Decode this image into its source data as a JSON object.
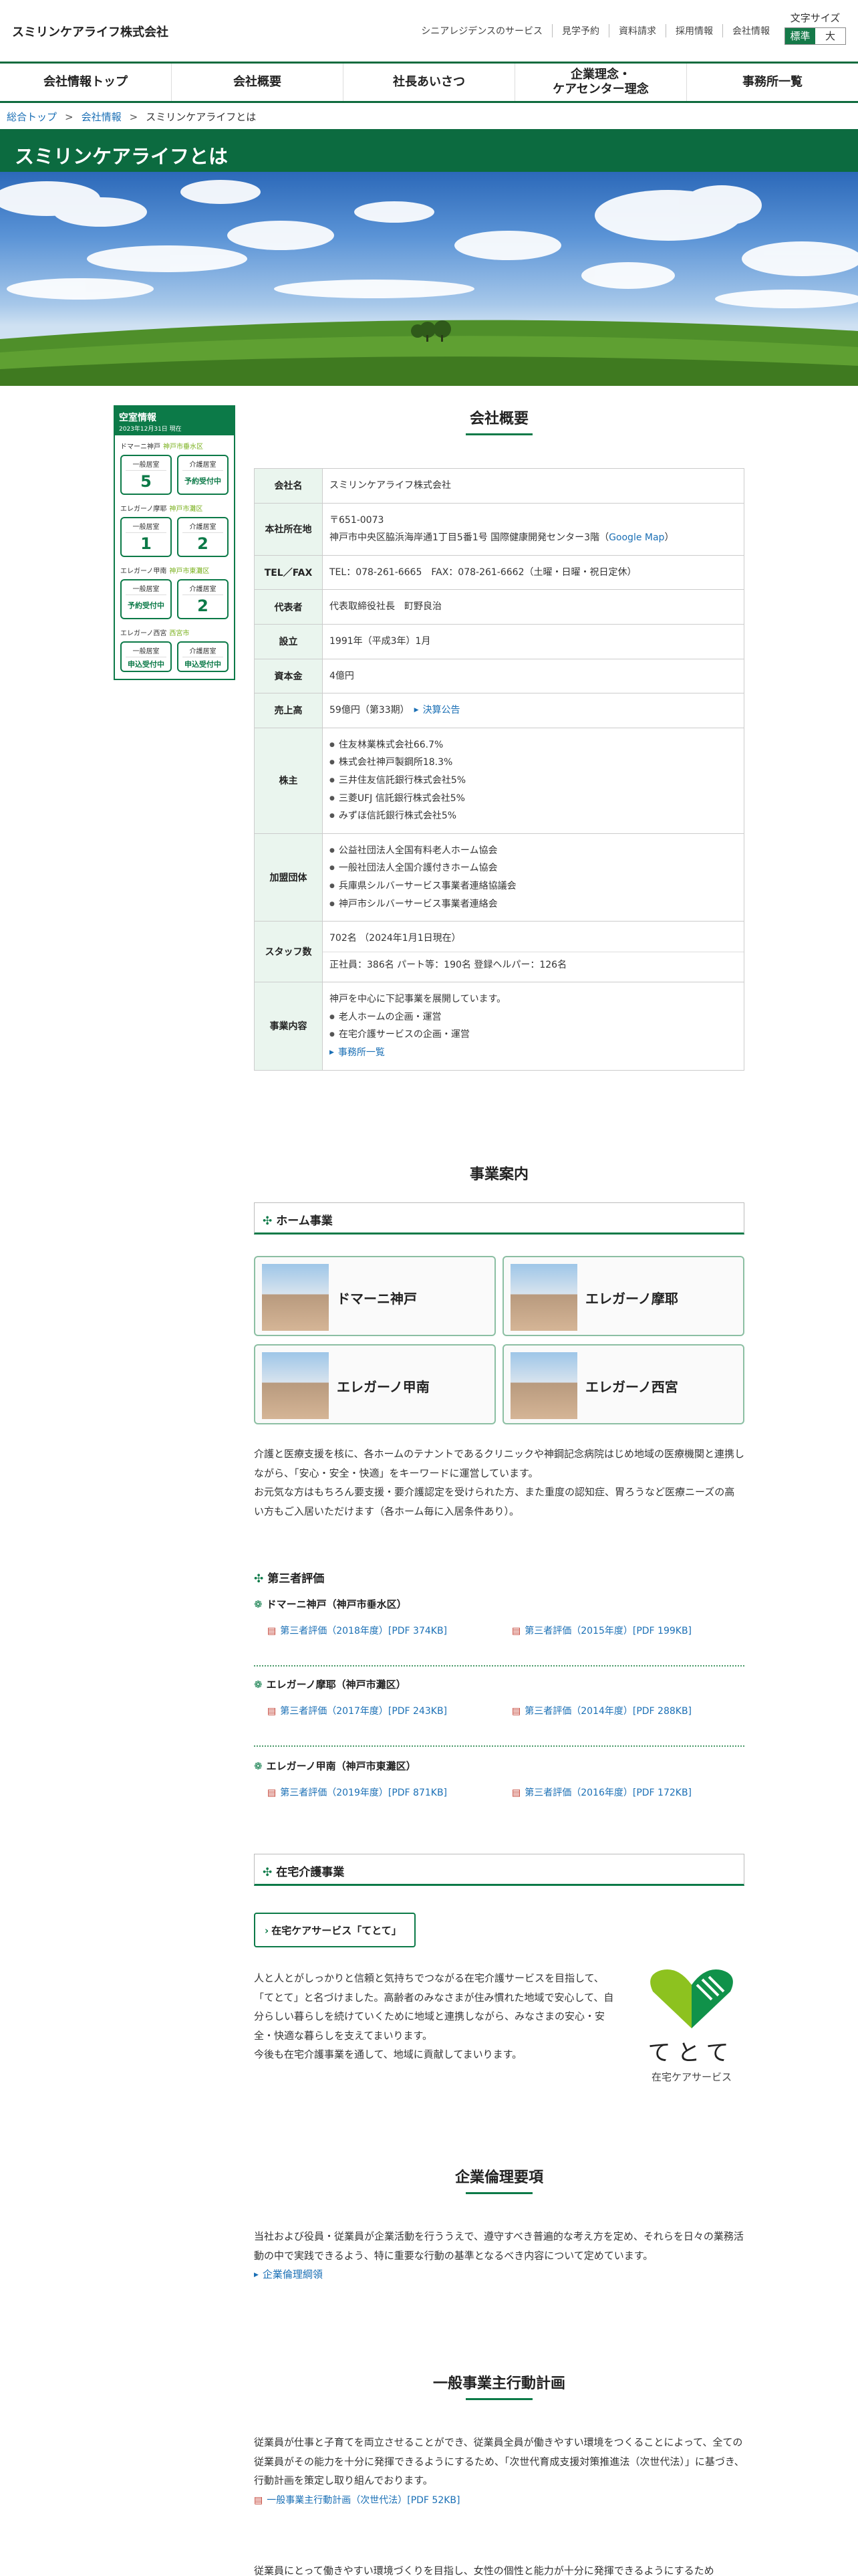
{
  "header": {
    "logo": "スミリンケアライフ株式会社",
    "util_links": [
      "シニアレジデンスのサービス",
      "見学予約",
      "資料請求",
      "採用情報",
      "会社情報"
    ],
    "font_size": {
      "label": "文字サイズ",
      "standard": "標準",
      "large": "大"
    }
  },
  "nav": {
    "items": [
      "会社情報トップ",
      "会社概要",
      "社長あいさつ",
      "企業理念・\nケアセンター理念",
      "事務所一覧"
    ]
  },
  "breadcrumb": {
    "items": [
      "総合トップ",
      "会社情報",
      "スミリンケアライフとは"
    ],
    "sep": ">"
  },
  "page_title": "スミリンケアライフとは",
  "vacancy": {
    "title": "空室情報",
    "date": "2023年12月31日 現在",
    "facilities": [
      {
        "name": "ドマーニ神戸",
        "area": "神戸市垂水区",
        "general_label": "一般居室",
        "general": "5",
        "care_label": "介護居室",
        "care": "予約受付中"
      },
      {
        "name": "エレガーノ摩耶",
        "area": "神戸市灘区",
        "general_label": "一般居室",
        "general": "1",
        "care_label": "介護居室",
        "care": "2"
      },
      {
        "name": "エレガーノ甲南",
        "area": "神戸市東灘区",
        "general_label": "一般居室",
        "general": "予約受付中",
        "care_label": "介護居室",
        "care": "2"
      },
      {
        "name": "エレガーノ西宮",
        "area": "西宮市",
        "general_label": "一般居室",
        "general": "申込受付中",
        "care_label": "介護居室",
        "care": "申込受付中"
      }
    ]
  },
  "company": {
    "title": "会社概要",
    "rows": {
      "name": {
        "label": "会社名",
        "value": "スミリンケアライフ株式会社"
      },
      "address": {
        "label": "本社所在地",
        "postal": "〒651-0073",
        "line": "神戸市中央区脇浜海岸通1丁目5番1号 国際健康開発センター3階（",
        "map": "Google Map",
        "end": "）"
      },
      "tel": {
        "label": "TEL／FAX",
        "value": "TEL：078-261-6665　FAX：078-261-6662（土曜・日曜・祝日定休）"
      },
      "rep": {
        "label": "代表者",
        "value": "代表取締役社長　町野良治"
      },
      "founded": {
        "label": "設立",
        "value": "1991年（平成3年）1月"
      },
      "capital": {
        "label": "資本金",
        "value": "4億円"
      },
      "sales": {
        "label": "売上高",
        "value": "59億円（第33期）",
        "link": "決算公告"
      },
      "holders": {
        "label": "株主",
        "items": [
          "住友林業株式会社66.7%",
          "株式会社神戸製鋼所18.3%",
          "三井住友信託銀行株式会社5%",
          "三菱UFJ 信託銀行株式会社5%",
          "みずほ信託銀行株式会社5%"
        ]
      },
      "groups": {
        "label": "加盟団体",
        "items": [
          "公益社団法人全国有料老人ホーム協会",
          "一般社団法人全国介護付きホーム協会",
          "兵庫県シルバーサービス事業者連絡協議会",
          "神戸市シルバーサービス事業者連絡会"
        ]
      },
      "staff": {
        "label": "スタッフ数",
        "total": "702名 （2024年1月1日現在）",
        "detail": "正社員：386名 パート等：190名 登録ヘルパー：126名"
      },
      "business": {
        "label": "事業内容",
        "intro": "神戸を中心に下記事業を展開しています。",
        "items": [
          "老人ホームの企画・運営",
          "在宅介護サービスの企画・運営"
        ],
        "link": "事務所一覧"
      }
    }
  },
  "business": {
    "title": "事業案内",
    "home": {
      "heading": "ホーム事業",
      "cards": [
        "ドマーニ神戸",
        "エレガーノ摩耶",
        "エレガーノ甲南",
        "エレガーノ西宮"
      ],
      "text1": "介護と医療支援を核に、各ホームのテナントであるクリニックや神鋼記念病院はじめ地域の医療機関と連携しながら、「安心・安全・快適」をキーワードに運営しています。",
      "text2": "お元気な方はもちろん要支援・要介護認定を受けられた方、また重度の認知症、胃ろうなど医療ニーズの高い方もご入居いただけます（各ホーム毎に入居条件あり）。"
    },
    "evaluation": {
      "heading": "第三者評価",
      "groups": [
        {
          "name": "ドマーニ神戸（神戸市垂水区）",
          "links": [
            "第三者評価（2018年度）[PDF 374KB]",
            "第三者評価（2015年度）[PDF 199KB]"
          ]
        },
        {
          "name": "エレガーノ摩耶（神戸市灘区）",
          "links": [
            "第三者評価（2017年度）[PDF 243KB]",
            "第三者評価（2014年度）[PDF 288KB]"
          ]
        },
        {
          "name": "エレガーノ甲南（神戸市東灘区）",
          "links": [
            "第三者評価（2019年度）[PDF 871KB]",
            "第三者評価（2016年度）[PDF 172KB]"
          ]
        }
      ]
    },
    "homecare": {
      "heading": "在宅介護事業",
      "button": "在宅ケアサービス「てとて」",
      "text": [
        "人と人とがしっかりと信頼と気持ちでつながる在宅介護サービスを目指して、",
        "「てとて」と名づけました。高齢者のみなさまが住み慣れた地域で安心して、自",
        "分らしい暮らしを続けていくために地域と連携しながら、みなさまの安心・安",
        "全・快適な暮らしを支えてまいります。",
        "今後も在宅介護事業を通して、地域に貢献してまいります。"
      ],
      "logo_text": "てとて",
      "logo_sub": "在宅ケアサービス"
    }
  },
  "ethics": {
    "title": "企業倫理要項",
    "text": "当社および役員・従業員が企業活動を行ううえで、遵守すべき普遍的な考え方を定め、それらを日々の業務活動の中で実践できるよう、特に重要な行動の基準となるべき内容について定めています。",
    "link": "企業倫理綱領"
  },
  "action": {
    "title": "一般事業主行動計画",
    "text": "従業員が仕事と子育てを両立させることができ、従業員全員が働きやすい環境をつくることによって、全ての従業員がその能力を十分に発揮できるようにするため、「次世代育成支援対策推進法（次世代法）」に基づき、行動計画を策定し取り組んでおります。",
    "link": "一般事業主行動計画（次世代法）[PDF 52KB]",
    "text2": "従業員にとって働きやすい環境づくりを目指し、女性の個性と能力が十分に発揮できるようにするため"
  },
  "colors": {
    "brand_green": "#0c6b40",
    "link": "#1a6fb5",
    "accent_lime": "#7ab11e"
  }
}
